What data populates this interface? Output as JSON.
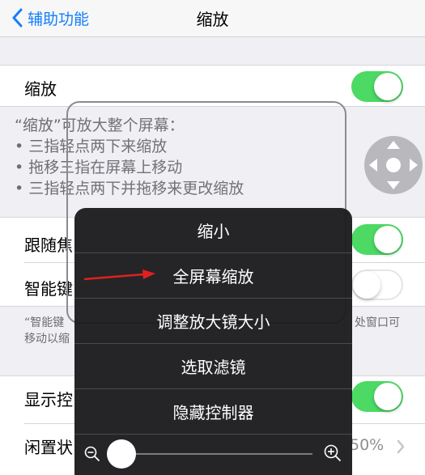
{
  "navbar": {
    "back_label": "辅助功能",
    "title": "缩放"
  },
  "zoom_row": {
    "label": "缩放",
    "enabled": true
  },
  "zoom_desc": {
    "heading": "“缩放”可放大整个屏幕：",
    "lines": [
      "• 三指轻点两下来缩放",
      "• 拖移三指在屏幕上移动",
      "• 三指轻点两下并拖移来更改缩放"
    ]
  },
  "follow_focus_row": {
    "label": "跟随焦",
    "enabled": true
  },
  "smart_keyboard_row": {
    "label": "智能键",
    "enabled": false
  },
  "smart_keyboard_footer": {
    "left": "“智能键",
    "left2": "移动以缩",
    "right": "处窗口可"
  },
  "show_controller_row": {
    "label": "显示控",
    "enabled": true
  },
  "idle_row": {
    "label": "闲置状",
    "value": "50%"
  },
  "zoom_menu": {
    "items": [
      "缩小",
      "全屏幕缩放",
      "调整放大镜大小",
      "选取滤镜",
      "隐藏控制器"
    ],
    "zoom_level": 0
  },
  "colors": {
    "accent": "#147efb",
    "toggle_on": "#4cd964",
    "arrow": "#e02020",
    "menu_bg": "#1c1c1e"
  }
}
